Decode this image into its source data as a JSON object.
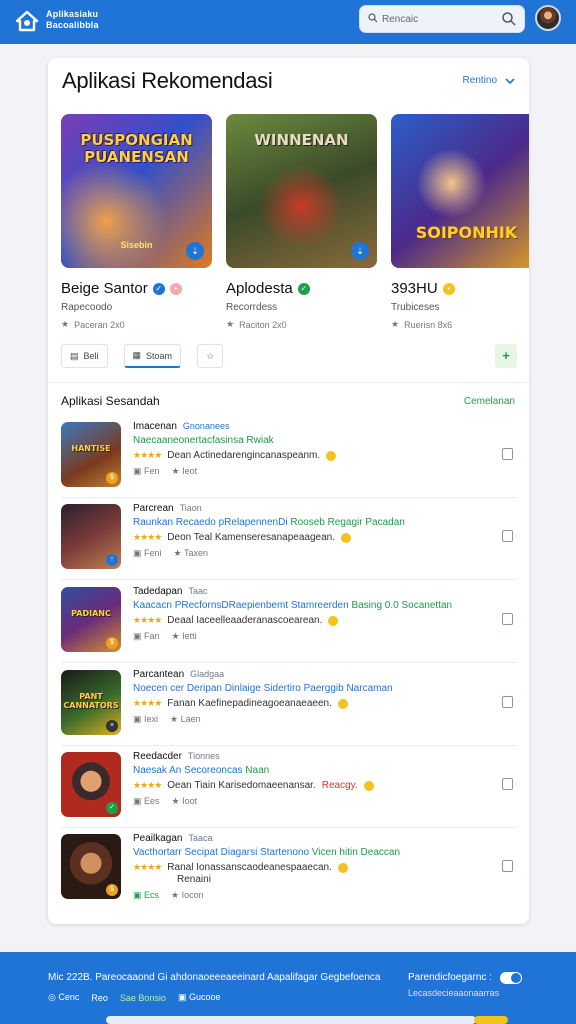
{
  "header": {
    "brand_line1": "Aplikasiaku",
    "brand_line2": "Bacoalibbla",
    "search_placeholder": "Rencaic"
  },
  "main": {
    "title": "Aplikasi Rekomendasi",
    "filter_label": "Rentino"
  },
  "featured": [
    {
      "art_title": "PUSPONGIAN PUANENSAN",
      "art_sub": "Sisebin",
      "name": "Beige Santor",
      "dev": "Rapecoodo",
      "meta": "Paceran 2x0",
      "badge_color": "#1f74d6",
      "badge2_color": "#f4a8b0"
    },
    {
      "art_title": "WINNENAN",
      "art_sub": "",
      "name": "Aplodesta",
      "dev": "Recorrdess",
      "meta": "Raciton 2x0",
      "badge_color": "#1ea04a",
      "badge2_color": ""
    },
    {
      "art_title": "",
      "art_sub": "SOIPONHIK",
      "name": "393HU",
      "dev": "Trubiceses",
      "meta": "Ruerisn 8x6",
      "badge_color": "#f4c21d",
      "badge2_color": ""
    }
  ],
  "tabs": [
    {
      "label": "Beli"
    },
    {
      "label": "Stoam"
    },
    {
      "label": ""
    }
  ],
  "list_section": {
    "title": "Aplikasi Sesandah",
    "link": "Cemelanan"
  },
  "list_items": [
    {
      "thumb_label": "HANTISE",
      "title": "Imacenan",
      "sub": "Gnonanees",
      "desc": "Naecaaneonertacfasinsa Rwiak",
      "desc_green": "",
      "line3": "Dean Actinedarengincanaspeanm.",
      "warn": "",
      "extra": "",
      "meta1": "Fen",
      "meta2": "Ieot"
    },
    {
      "thumb_label": "",
      "title": "Parcrean",
      "sub": "Tiaon",
      "desc": "Raunkan Recaedo pRelapennenDi ",
      "desc_green": "Rooseb Regagir Pacadan",
      "line3": "Deon Teal Kamenseresanapeaagean.",
      "warn": "",
      "extra": "",
      "meta1": "Feni",
      "meta2": "Taxen"
    },
    {
      "thumb_label": "PADIANC",
      "title": "Tadedapan",
      "sub": "Taac",
      "desc": "Kaacacn PRecfornsDRaepienbemt Stamreerden",
      "desc_green": "Basing 0.0 Socanettan",
      "line3": "Deaal Iaceelleaaderanascoearean.",
      "warn": "",
      "extra": "",
      "meta1": "Fan",
      "meta2": "Ietti"
    },
    {
      "thumb_label": "PANT CANNATORS",
      "title": "Parcantean",
      "sub": "Gladgaa",
      "desc": "Noecen cer Deripan Dinlaige Sidertiro Paerggib ",
      "desc_green": "Narcaman",
      "line3": "Fanan Kaefinepadineagoeanaeaeen.",
      "warn": "",
      "extra": "",
      "meta1": "Iexi",
      "meta2": "Laen"
    },
    {
      "thumb_label": "",
      "title": "Reedacder",
      "sub": "Tionnes",
      "desc": "Naesak An Secoreoncas ",
      "desc_green": "Naan",
      "line3": "Oean Tiain Karisedomaeenansar.",
      "warn": "Reacgy.",
      "extra": "",
      "meta1": "Ees",
      "meta2": "Ioot"
    },
    {
      "thumb_label": "",
      "title": "Peailkagan",
      "sub": "Taaca",
      "desc": "Vacthortarr Secipat Diagarsi Startenono ",
      "desc_green": "Vicen hitin Deaccan",
      "line3": "Ranal Ionassanscaodeanespaaecan.",
      "warn": "",
      "extra": "Renaini",
      "meta1": "Ecs",
      "meta2": "Iocon"
    }
  ],
  "footer": {
    "text": "Mic 222B. Pareocaaond Gi ahdonaoeeeaeeinard Aapalifagar Gegbefoenca",
    "row_items": [
      "Cenc",
      "Reo",
      "Sae Bonsio",
      "Gucooe"
    ],
    "right_title": "Parendicfoegarnc :",
    "right_sub": "Lecasdecieaaonaarras"
  },
  "colors": {
    "primary": "#1f74d6",
    "accent_green": "#1ea04a",
    "star": "#f2a51a"
  }
}
